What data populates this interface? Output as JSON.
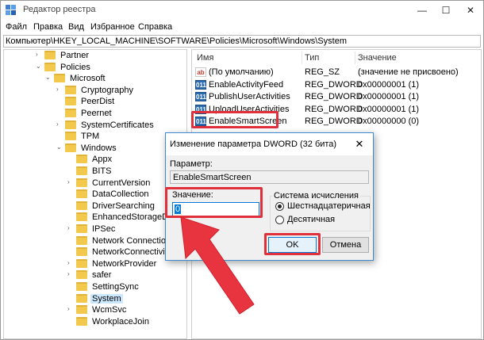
{
  "window": {
    "title": "Редактор реестра",
    "controls": {
      "minimize": "—",
      "maximize": "☐",
      "close": "✕"
    }
  },
  "menu": [
    "Файл",
    "Правка",
    "Вид",
    "Избранное",
    "Справка"
  ],
  "address": "Компьютер\\HKEY_LOCAL_MACHINE\\SOFTWARE\\Policies\\Microsoft\\Windows\\System",
  "tree": [
    {
      "label": "Partner",
      "arrow": "›",
      "selected": false
    },
    {
      "label": "Policies",
      "arrow": "⌄",
      "selected": false
    },
    {
      "label": "Microsoft",
      "arrow": "⌄",
      "selected": false
    },
    {
      "label": "Cryptography",
      "arrow": "›",
      "selected": false
    },
    {
      "label": "PeerDist",
      "arrow": "",
      "selected": false
    },
    {
      "label": "Peernet",
      "arrow": "",
      "selected": false
    },
    {
      "label": "SystemCertificates",
      "arrow": "›",
      "selected": false
    },
    {
      "label": "TPM",
      "arrow": "",
      "selected": false
    },
    {
      "label": "Windows",
      "arrow": "⌄",
      "selected": false
    },
    {
      "label": "Appx",
      "arrow": "",
      "selected": false
    },
    {
      "label": "BITS",
      "arrow": "",
      "selected": false
    },
    {
      "label": "CurrentVersion",
      "arrow": "›",
      "selected": false
    },
    {
      "label": "DataCollection",
      "arrow": "",
      "selected": false
    },
    {
      "label": "DriverSearching",
      "arrow": "",
      "selected": false
    },
    {
      "label": "EnhancedStorageDev",
      "arrow": "",
      "selected": false
    },
    {
      "label": "IPSec",
      "arrow": "›",
      "selected": false
    },
    {
      "label": "Network Connections",
      "arrow": "",
      "selected": false
    },
    {
      "label": "NetworkConnectivity",
      "arrow": "",
      "selected": false
    },
    {
      "label": "NetworkProvider",
      "arrow": "›",
      "selected": false
    },
    {
      "label": "safer",
      "arrow": "›",
      "selected": false
    },
    {
      "label": "SettingSync",
      "arrow": "",
      "selected": false
    },
    {
      "label": "System",
      "arrow": "",
      "selected": true
    },
    {
      "label": "WcmSvc",
      "arrow": "›",
      "selected": false
    },
    {
      "label": "WorkplaceJoin",
      "arrow": "",
      "selected": false
    }
  ],
  "list": {
    "headers": {
      "name": "Имя",
      "type": "Тип",
      "value": "Значение"
    },
    "rows": [
      {
        "icon": "ab",
        "kind": "sz",
        "name": "(По умолчанию)",
        "type": "REG_SZ",
        "value": "(значение не присвоено)"
      },
      {
        "icon": "011",
        "kind": "dw",
        "name": "EnableActivityFeed",
        "type": "REG_DWORD",
        "value": "0x00000001 (1)"
      },
      {
        "icon": "011",
        "kind": "dw",
        "name": "PublishUserActivities",
        "type": "REG_DWORD",
        "value": "0x00000001 (1)"
      },
      {
        "icon": "011",
        "kind": "dw",
        "name": "UploadUserActivities",
        "type": "REG_DWORD",
        "value": "0x00000001 (1)"
      },
      {
        "icon": "011",
        "kind": "dw",
        "name": "EnableSmartScreen",
        "type": "REG_DWORD",
        "value": "0x00000000 (0)"
      }
    ]
  },
  "dialog": {
    "title": "Изменение параметра DWORD (32 бита)",
    "close": "✕",
    "param_label": "Параметр:",
    "param_value": "EnableSmartScreen",
    "value_label": "Значение:",
    "value": "0",
    "base_label": "Система исчисления",
    "radio_hex": "Шестнадцатеричная",
    "radio_dec": "Десятичная",
    "ok": "OK",
    "cancel": "Отмена"
  },
  "colors": {
    "highlight": "#e0303c",
    "accent": "#0078d7",
    "selection": "#cce8ff"
  }
}
